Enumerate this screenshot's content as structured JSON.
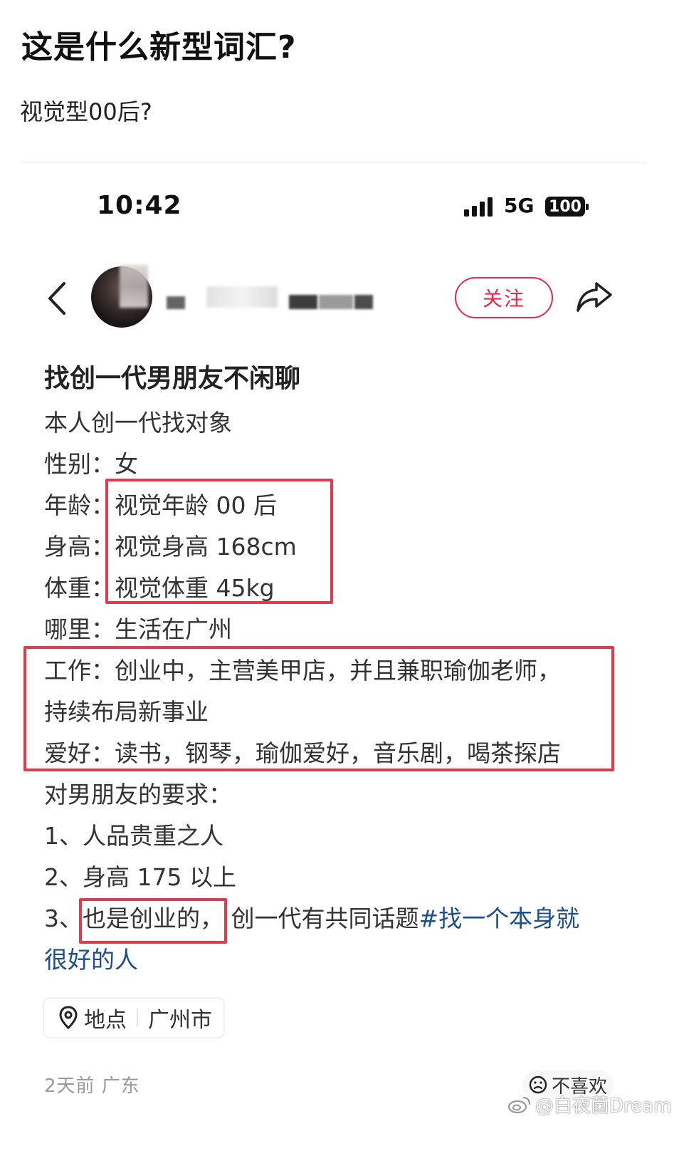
{
  "post": {
    "title": "这是什么新型词汇?",
    "subtitle": "视觉型00后?"
  },
  "status_bar": {
    "time": "10:42",
    "network": "5G",
    "battery": "100"
  },
  "note_header": {
    "follow_label": "关注"
  },
  "note": {
    "title": "找创一代男朋友不闲聊",
    "lines": [
      "本人创一代找对象",
      "性别：女",
      "年龄：视觉年龄 00 后",
      "身高：视觉身高 168cm",
      "体重：视觉体重 45kg",
      "哪里：生活在广州",
      "工作：创业中，主营美甲店，并且兼职瑜伽老师，",
      "持续布局新事业",
      "爱好：读书，钢琴，瑜伽爱好，音乐剧，喝茶探店",
      "对男朋友的要求：",
      "1、人品贵重之人",
      "2、身高 175 以上"
    ],
    "line3_prefix": "3、",
    "line3_highlight": "也是创业的，",
    "line3_text": "创一代有共同话题",
    "hashtag_part1": "#找一个本身就",
    "hashtag_part2": "很好的人"
  },
  "location": {
    "label": "地点",
    "city": "广州市"
  },
  "footer": {
    "meta": "2天前 广东",
    "dislike_label": "不喜欢"
  },
  "watermark": {
    "text": "@白夜菌Dream"
  },
  "colors": {
    "accent_red": "#e8294a",
    "highlight_box": "#e33a4c",
    "hashtag_blue": "#1d4f8c"
  },
  "icons": {
    "back": "chevron-left-icon",
    "share": "share-icon",
    "location": "location-pin-icon",
    "dislike": "sad-face-icon",
    "signal": "signal-bars-icon",
    "weibo": "weibo-logo-icon"
  }
}
